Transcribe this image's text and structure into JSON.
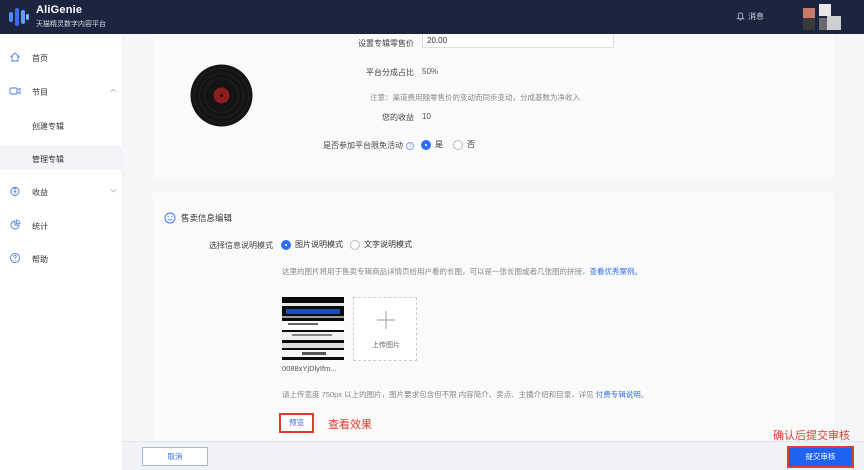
{
  "header": {
    "brand": "AliGenie",
    "brand_sub": "天猫精灵数字内容平台",
    "message_label": "消息"
  },
  "sidebar": {
    "items": [
      {
        "label": "首页",
        "icon": "home-icon"
      },
      {
        "label": "节目",
        "icon": "video-icon"
      },
      {
        "label": "创建专辑"
      },
      {
        "label": "管理专辑"
      },
      {
        "label": "收益",
        "icon": "income-icon"
      },
      {
        "label": "统计",
        "icon": "stats-icon"
      },
      {
        "label": "帮助",
        "icon": "help-icon"
      }
    ]
  },
  "pricing": {
    "price_label": "设置专辑零售价",
    "price_value": "20.00",
    "share_label": "平台分成占比",
    "share_value": "50%",
    "note": "注意：渠道费用随零售价的变动而同步变动，分成基数为净收入",
    "income_label": "您的收益",
    "income_value": "10",
    "promo_label": "是否参加平台限免活动",
    "promo_yes": "是",
    "promo_no": "否"
  },
  "sales": {
    "title": "售卖信息编辑",
    "mode_label": "选择信息说明模式",
    "mode_image": "图片说明模式",
    "mode_text": "文字说明模式",
    "desc": "这里的图片将用于售卖专辑商品详情页给用户看的长图，可以是一张长图或者几张图的拼接，",
    "desc_link": "查看优秀案例。",
    "upload_label": "上传图片",
    "file_name": "0088xYjDlyIfm...",
    "req": "请上传宽度 750px 以上的图片，图片要求包含但不限 内容简介、卖点、主播介绍和目录，详见 ",
    "req_link": "付费专辑说明",
    "req_end": "。",
    "preview_label": "预览"
  },
  "annotations": {
    "preview": "查看效果",
    "submit": "确认后提交审核"
  },
  "footer": {
    "cancel_label": "取消",
    "submit_label": "提交审核"
  },
  "colors": {
    "accent": "#2f6df6",
    "header_bg": "#1b2540",
    "annotation": "#e23b2e"
  }
}
